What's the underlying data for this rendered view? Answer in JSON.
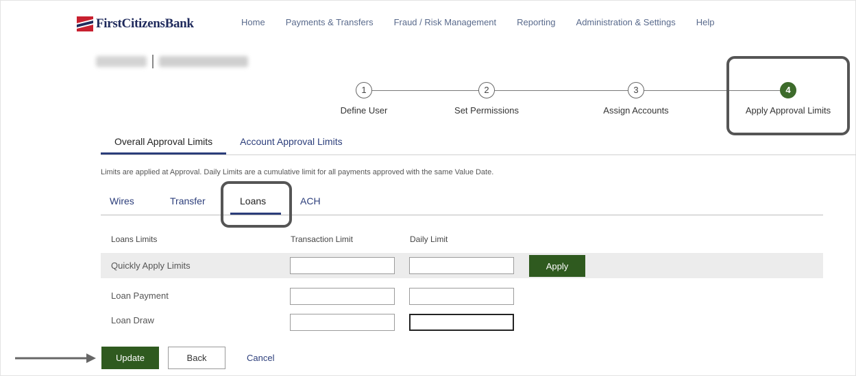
{
  "brand": {
    "name": "FirstCitizensBank",
    "primary": "#1f2a5c",
    "accent_red": "#c8202f",
    "green": "#2f5a1f"
  },
  "nav": {
    "items": [
      "Home",
      "Payments & Transfers",
      "Fraud / Risk Management",
      "Reporting",
      "Administration & Settings",
      "Help"
    ]
  },
  "stepper": {
    "steps": [
      {
        "number": "1",
        "label": "Define User"
      },
      {
        "number": "2",
        "label": "Set Permissions"
      },
      {
        "number": "3",
        "label": "Assign Accounts"
      },
      {
        "number": "4",
        "label": "Apply Approval Limits"
      }
    ],
    "active_step": 4
  },
  "tabs": {
    "overall": "Overall Approval Limits",
    "account": "Account Approval Limits"
  },
  "info_text": "Limits are applied at Approval. Daily Limits are a cumulative limit for all payments approved with the same Value Date.",
  "subtabs": {
    "wires": "Wires",
    "transfer": "Transfer",
    "loans": "Loans",
    "ach": "ACH"
  },
  "table": {
    "headers": {
      "name": "Loans Limits",
      "transaction": "Transaction Limit",
      "daily": "Daily Limit"
    },
    "rows": [
      {
        "label": "Quickly Apply Limits",
        "transaction": "",
        "daily": ""
      },
      {
        "label": "Loan Payment",
        "transaction": "",
        "daily": ""
      },
      {
        "label": "Loan Draw",
        "transaction": "",
        "daily": ""
      }
    ],
    "apply_label": "Apply"
  },
  "actions": {
    "update": "Update",
    "back": "Back",
    "cancel": "Cancel"
  }
}
